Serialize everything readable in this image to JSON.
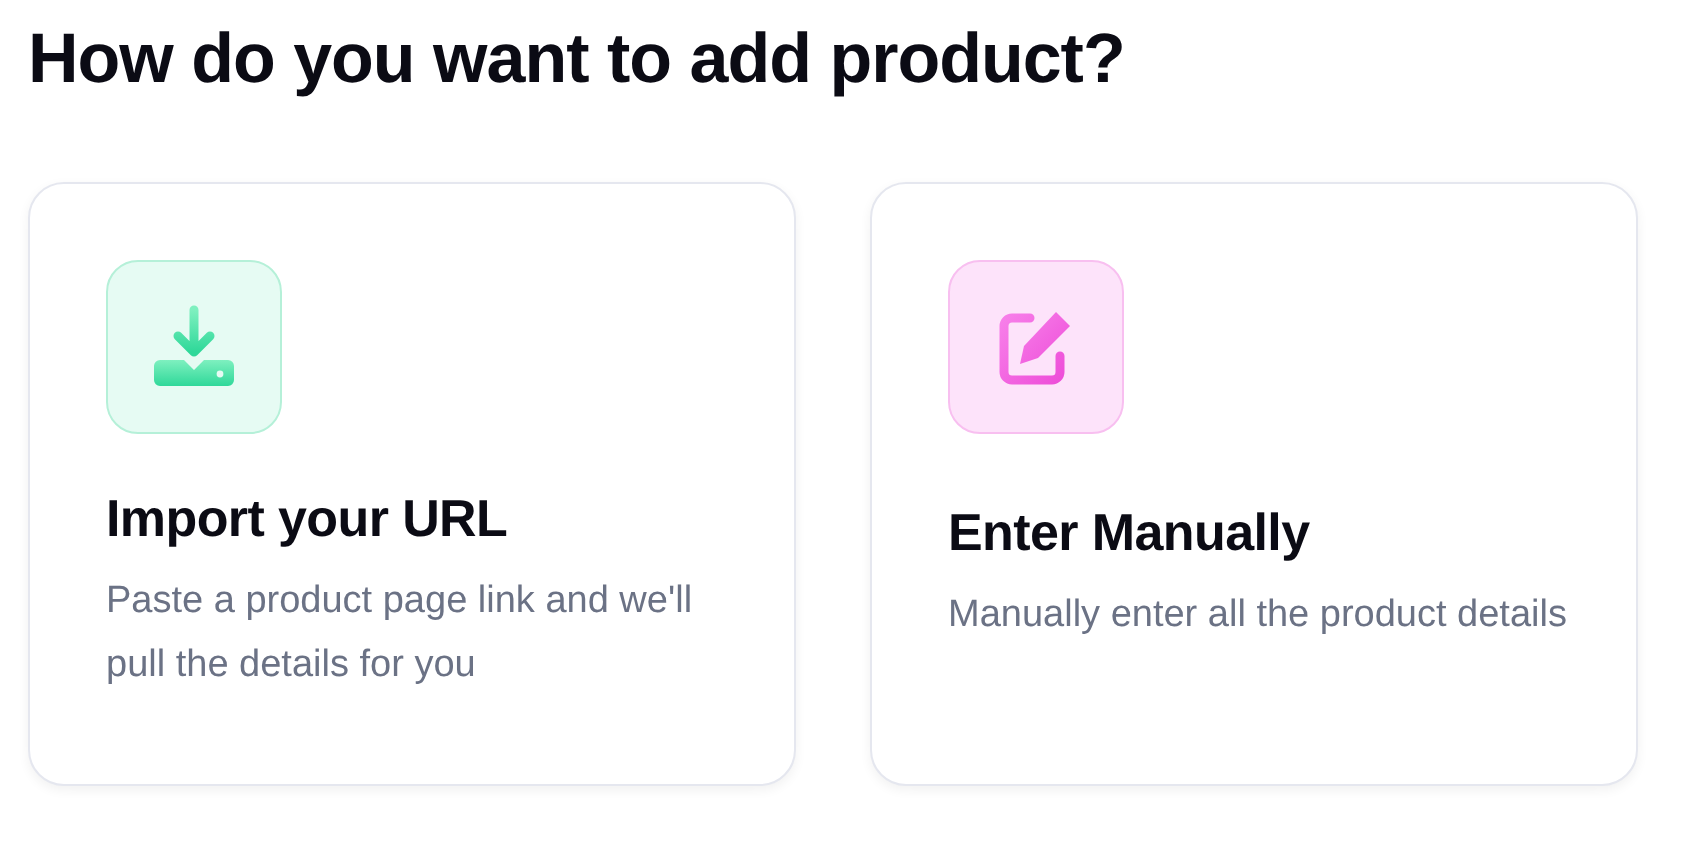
{
  "heading": "How do you want to add product?",
  "options": [
    {
      "kind": "import",
      "title": "Import your URL",
      "description": "Paste a product page link and we'll pull the details for you"
    },
    {
      "kind": "manual",
      "title": "Enter Manually",
      "description": "Manually enter all the product details"
    }
  ]
}
